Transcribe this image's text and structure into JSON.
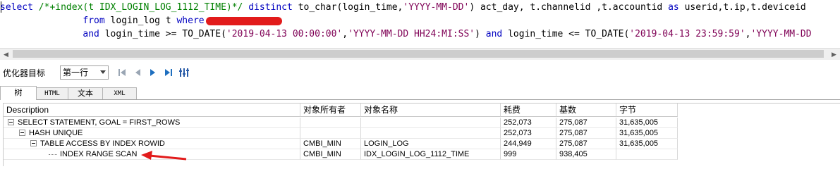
{
  "editor": {
    "line1": {
      "kw_select": "select",
      "hint": "/*+index(t IDX_LOGIN_LOG_1112_TIME)*/",
      "kw_distinct": "distinct",
      "to_char": "to_char(login_time,",
      "fmt1": "'YYYY-MM-DD'",
      "rest": ") act_day, t.channelid ,t.accountid",
      "kw_as": "as",
      "rest2": "userid,t.ip,t.deviceid"
    },
    "line2": {
      "kw_from": "from",
      "table": "login_log t",
      "kw_where": "where"
    },
    "line3": {
      "kw_and": "and",
      "cond1": "login_time >= TO_DATE(",
      "date1": "'2019-04-13 00:00:00'",
      "comma1": ",",
      "fmt2": "'YYYY-MM-DD HH24:MI:SS'",
      "close1": ")",
      "kw_and2": "and",
      "cond2": "login_time <= TO_DATE(",
      "date2": "'2019-04-13 23:59:59'",
      "comma2": ",",
      "fmt3": "'YYYY-MM-DD"
    }
  },
  "toolbar": {
    "label": "优化器目标",
    "selected_goal": "第一行",
    "buttons": [
      "first-icon",
      "prev-icon",
      "next-icon",
      "last-icon",
      "settings-icon"
    ]
  },
  "tabs": [
    {
      "label": "树",
      "active": true
    },
    {
      "label": "HTML",
      "active": false
    },
    {
      "label": "文本",
      "active": false
    },
    {
      "label": "XML",
      "active": false
    }
  ],
  "grid": {
    "columns": [
      "Description",
      "对象所有者",
      "对象名称",
      "耗费",
      "基数",
      "字节"
    ],
    "rows": [
      {
        "description": "SELECT STATEMENT, GOAL = FIRST_ROWS",
        "owner": "",
        "object": "",
        "cost": "252,073",
        "cardinality": "275,087",
        "bytes": "31,635,005"
      },
      {
        "description": "HASH UNIQUE",
        "owner": "",
        "object": "",
        "cost": "252,073",
        "cardinality": "275,087",
        "bytes": "31,635,005"
      },
      {
        "description": "TABLE ACCESS BY INDEX ROWID",
        "owner": "CMBI_MIN",
        "object": "LOGIN_LOG",
        "cost": "244,949",
        "cardinality": "275,087",
        "bytes": "31,635,005"
      },
      {
        "description": "INDEX RANGE SCAN",
        "owner": "CMBI_MIN",
        "object": "IDX_LOGIN_LOG_1112_TIME",
        "cost": "999",
        "cardinality": "938,405",
        "bytes": ""
      }
    ]
  },
  "colors": {
    "keyword": "#0000c0",
    "string": "#7f0055",
    "comment": "#008000",
    "annotation": "#e21b1b"
  }
}
